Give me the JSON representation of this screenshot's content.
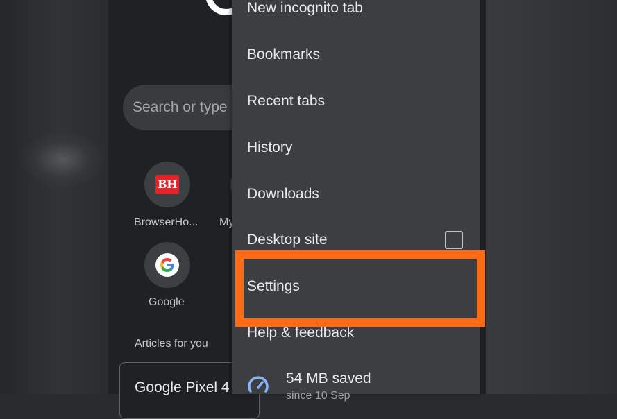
{
  "ntp": {
    "search_placeholder": "Search or type",
    "tiles": [
      {
        "label": "BrowserHo...",
        "badge": "BH",
        "icon": "browserhow-icon"
      },
      {
        "label": "My",
        "icon": "site-icon"
      },
      {
        "label": "Google",
        "icon": "google-icon"
      }
    ],
    "articles_heading": "Articles for you",
    "article_card_title": "Google Pixel 4"
  },
  "menu": {
    "items": [
      {
        "label": "New incognito tab"
      },
      {
        "label": "Bookmarks"
      },
      {
        "label": "Recent tabs"
      },
      {
        "label": "History"
      },
      {
        "label": "Downloads"
      },
      {
        "label": "Desktop site",
        "checkbox_checked": false
      },
      {
        "label": "Settings",
        "highlighted": true
      },
      {
        "label": "Help & feedback"
      }
    ],
    "data_saver": {
      "icon": "speedometer-icon",
      "label": "54 MB saved",
      "sub": "since 10 Sep"
    }
  },
  "colors": {
    "highlight": "#ff6a13",
    "menu_bg": "#3c3e42",
    "page_bg": "#202124",
    "bh_red": "#e52228"
  }
}
